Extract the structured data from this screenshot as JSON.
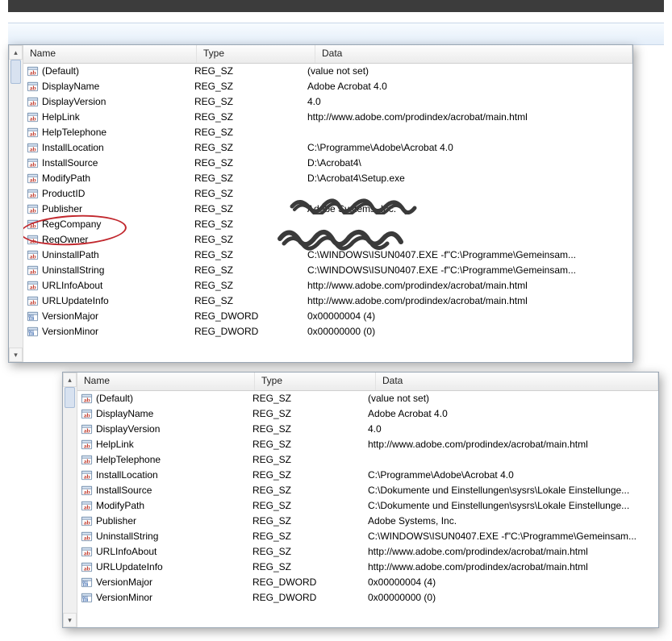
{
  "headers": {
    "name": "Name",
    "type": "Type",
    "data": "Data"
  },
  "panel1": {
    "rows": [
      {
        "icon": "ab",
        "name": "(Default)",
        "type": "REG_SZ",
        "data": "(value not set)"
      },
      {
        "icon": "ab",
        "name": "DisplayName",
        "type": "REG_SZ",
        "data": "Adobe Acrobat 4.0"
      },
      {
        "icon": "ab",
        "name": "DisplayVersion",
        "type": "REG_SZ",
        "data": "4.0"
      },
      {
        "icon": "ab",
        "name": "HelpLink",
        "type": "REG_SZ",
        "data": "http://www.adobe.com/prodindex/acrobat/main.html"
      },
      {
        "icon": "ab",
        "name": "HelpTelephone",
        "type": "REG_SZ",
        "data": ""
      },
      {
        "icon": "ab",
        "name": "InstallLocation",
        "type": "REG_SZ",
        "data": "C:\\Programme\\Adobe\\Acrobat 4.0"
      },
      {
        "icon": "ab",
        "name": "InstallSource",
        "type": "REG_SZ",
        "data": "D:\\Acrobat4\\"
      },
      {
        "icon": "ab",
        "name": "ModifyPath",
        "type": "REG_SZ",
        "data": "D:\\Acrobat4\\Setup.exe"
      },
      {
        "icon": "ab",
        "name": "ProductID",
        "type": "REG_SZ",
        "data": ""
      },
      {
        "icon": "ab",
        "name": "Publisher",
        "type": "REG_SZ",
        "data": "Adobe Systems, Inc."
      },
      {
        "icon": "ab",
        "name": "RegCompany",
        "type": "REG_SZ",
        "data": ""
      },
      {
        "icon": "ab",
        "name": "RegOwner",
        "type": "REG_SZ",
        "data": ""
      },
      {
        "icon": "ab",
        "name": "UninstallPath",
        "type": "REG_SZ",
        "data": "C:\\WINDOWS\\ISUN0407.EXE -f\"C:\\Programme\\Gemeinsam..."
      },
      {
        "icon": "ab",
        "name": "UninstallString",
        "type": "REG_SZ",
        "data": "C:\\WINDOWS\\ISUN0407.EXE -f\"C:\\Programme\\Gemeinsam..."
      },
      {
        "icon": "ab",
        "name": "URLInfoAbout",
        "type": "REG_SZ",
        "data": "http://www.adobe.com/prodindex/acrobat/main.html"
      },
      {
        "icon": "ab",
        "name": "URLUpdateInfo",
        "type": "REG_SZ",
        "data": "http://www.adobe.com/prodindex/acrobat/main.html"
      },
      {
        "icon": "num",
        "name": "VersionMajor",
        "type": "REG_DWORD",
        "data": "0x00000004 (4)"
      },
      {
        "icon": "num",
        "name": "VersionMinor",
        "type": "REG_DWORD",
        "data": "0x00000000 (0)"
      }
    ]
  },
  "panel2": {
    "rows": [
      {
        "icon": "ab",
        "name": "(Default)",
        "type": "REG_SZ",
        "data": "(value not set)"
      },
      {
        "icon": "ab",
        "name": "DisplayName",
        "type": "REG_SZ",
        "data": "Adobe Acrobat 4.0"
      },
      {
        "icon": "ab",
        "name": "DisplayVersion",
        "type": "REG_SZ",
        "data": "4.0"
      },
      {
        "icon": "ab",
        "name": "HelpLink",
        "type": "REG_SZ",
        "data": "http://www.adobe.com/prodindex/acrobat/main.html"
      },
      {
        "icon": "ab",
        "name": "HelpTelephone",
        "type": "REG_SZ",
        "data": ""
      },
      {
        "icon": "ab",
        "name": "InstallLocation",
        "type": "REG_SZ",
        "data": "C:\\Programme\\Adobe\\Acrobat 4.0"
      },
      {
        "icon": "ab",
        "name": "InstallSource",
        "type": "REG_SZ",
        "data": "C:\\Dokumente und Einstellungen\\sysrs\\Lokale Einstellunge..."
      },
      {
        "icon": "ab",
        "name": "ModifyPath",
        "type": "REG_SZ",
        "data": "C:\\Dokumente und Einstellungen\\sysrs\\Lokale Einstellunge..."
      },
      {
        "icon": "ab",
        "name": "Publisher",
        "type": "REG_SZ",
        "data": "Adobe Systems, Inc."
      },
      {
        "icon": "ab",
        "name": "UninstallString",
        "type": "REG_SZ",
        "data": "C:\\WINDOWS\\ISUN0407.EXE -f\"C:\\Programme\\Gemeinsam..."
      },
      {
        "icon": "ab",
        "name": "URLInfoAbout",
        "type": "REG_SZ",
        "data": "http://www.adobe.com/prodindex/acrobat/main.html"
      },
      {
        "icon": "ab",
        "name": "URLUpdateInfo",
        "type": "REG_SZ",
        "data": "http://www.adobe.com/prodindex/acrobat/main.html"
      },
      {
        "icon": "num",
        "name": "VersionMajor",
        "type": "REG_DWORD",
        "data": "0x00000004 (4)"
      },
      {
        "icon": "num",
        "name": "VersionMinor",
        "type": "REG_DWORD",
        "data": "0x00000000 (0)"
      }
    ]
  }
}
